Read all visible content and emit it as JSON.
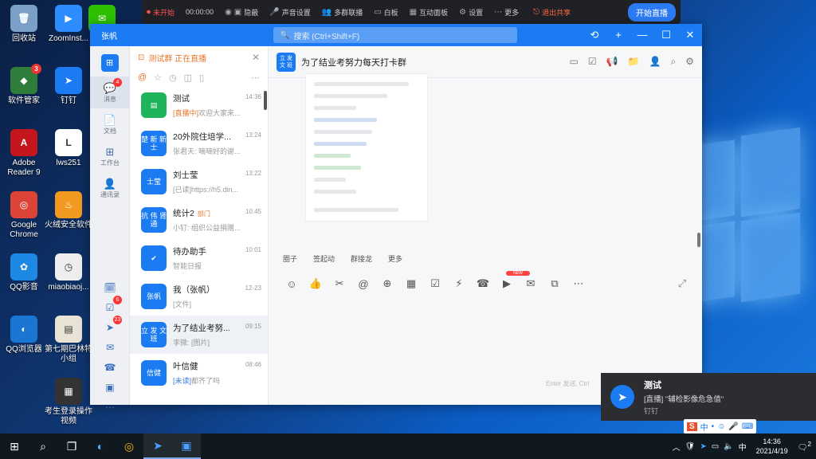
{
  "desktop": {
    "col1": [
      {
        "label": "回收站",
        "icon": "recycle-bin-icon",
        "color": "#7aa0c8",
        "glyph": "🗑"
      },
      {
        "label": "软件管家",
        "icon": "software-manager-icon",
        "color": "#2f7d3a",
        "glyph": "◆",
        "badge": "3"
      },
      {
        "label": "Adobe Reader 9",
        "icon": "adobe-reader-icon",
        "color": "#c4161c",
        "glyph": "A"
      },
      {
        "label": "Google Chrome",
        "icon": "chrome-icon",
        "color": "#db4437",
        "glyph": "◎"
      },
      {
        "label": "QQ影音",
        "icon": "qq-player-icon",
        "color": "#1e88e5",
        "glyph": "✿"
      },
      {
        "label": "QQ浏览器",
        "icon": "qq-browser-icon",
        "color": "#1976d2",
        "glyph": "◐"
      }
    ],
    "col2": [
      {
        "label": "ZoomInst...",
        "icon": "zoom-icon",
        "color": "#2d8cff",
        "glyph": "▶"
      },
      {
        "label": "钉钉",
        "icon": "dingtalk-icon",
        "color": "#1b7bf2",
        "glyph": "➤"
      },
      {
        "label": "lws251",
        "icon": "logitech-icon",
        "color": "#ffffff",
        "glyph": "L"
      },
      {
        "label": "火绒安全软件",
        "icon": "huorong-icon",
        "color": "#f29a1f",
        "glyph": "♨"
      },
      {
        "label": "miaobiaoj...",
        "icon": "stopwatch-icon",
        "color": "#eeeeee",
        "glyph": "◷"
      },
      {
        "label": "第七期巴林特小组",
        "icon": "document-icon",
        "color": "#e9e3d6",
        "glyph": "▤"
      },
      {
        "label": "考生登录操作视频",
        "icon": "video-file-icon",
        "color": "#333333",
        "glyph": "▦"
      }
    ],
    "wechat": {
      "label": "",
      "icon": "wechat-icon",
      "color": "#2dc100",
      "glyph": "✉"
    }
  },
  "meeting_bar": {
    "rec_status": "未开始",
    "timer": "00:00:00",
    "items": [
      "隐蔽",
      "声音设置",
      "多群联播",
      "白板",
      "互动面板",
      "设置",
      "更多"
    ],
    "stop_share": "退出共享",
    "start_live": "开始直播"
  },
  "window": {
    "user": "张帆",
    "search_placeholder": "搜索 (Ctrl+Shift+F)",
    "controls": [
      "⟲",
      "+",
      "—",
      "☐",
      "✕"
    ]
  },
  "nav": {
    "items": [
      {
        "label": "消息",
        "glyph": "💬",
        "badge": "4",
        "active": true
      },
      {
        "label": "文档",
        "glyph": "📄"
      },
      {
        "label": "工作台",
        "glyph": "⊞"
      },
      {
        "label": "通讯录",
        "glyph": "👤"
      }
    ],
    "lower": [
      {
        "glyph": "🗓",
        "badge": ""
      },
      {
        "glyph": "☑",
        "badge": "6"
      },
      {
        "glyph": "➤",
        "badge": "23"
      },
      {
        "glyph": "✉",
        "badge": ""
      },
      {
        "glyph": "☎",
        "badge": ""
      },
      {
        "glyph": "▣",
        "badge": ""
      },
      {
        "glyph": "⋯",
        "badge": ""
      }
    ]
  },
  "convlist": {
    "live_banner": "测试群 正在直播",
    "items": [
      {
        "avatar": "▤",
        "green": true,
        "title": "测试",
        "tag": "",
        "prefix": "[直播中]",
        "prefix_style": "orange",
        "msg": "欢迎大家来...",
        "time": "14:36"
      },
      {
        "avatar": "楚 新 新 士",
        "title": "20外院住培学...",
        "tag": "",
        "prefix": "",
        "msg": "张君天: 嘀嘀好的谢...",
        "time": "13:24"
      },
      {
        "avatar": "士莹",
        "title": "刘士莹",
        "tag": "",
        "prefix": "",
        "msg": "[已读]https://h5.din...",
        "time": "13:22"
      },
      {
        "avatar": "抗 伟 肾 通",
        "title": "统计2",
        "tag": "部门",
        "prefix": "",
        "msg": "小钉: 组织公益捐赠...",
        "time": "10:45"
      },
      {
        "avatar": "✔",
        "title": "待办助手",
        "tag": "",
        "prefix": "",
        "msg": "智能日报",
        "time": "10:01"
      },
      {
        "avatar": "张帆",
        "title": "我（张帆）",
        "tag": "",
        "prefix": "",
        "msg": "[文件]",
        "time": "12-23"
      },
      {
        "avatar": "立 发 文 班",
        "title": "为了结业考努...",
        "tag": "",
        "prefix": "",
        "msg": "李微: [图片]",
        "time": "09:15",
        "selected": true
      },
      {
        "avatar": "信健",
        "title": "叶信健",
        "tag": "",
        "prefix": "[未读]",
        "prefix_style": "blue",
        "msg": "都齐了吗",
        "time": "08:46"
      }
    ]
  },
  "chat": {
    "group_avatar": "立 发 文 班",
    "group_name": "为了结业考努力每天打卡群",
    "quick_actions": [
      "圈子",
      "签起动",
      "群接龙",
      "更多"
    ],
    "toolbar_icons": [
      "☺",
      "👍",
      "✂",
      "@",
      "⊕",
      "▦",
      "☑",
      "⚡",
      "☎",
      "▶",
      "✉",
      "⧉",
      "⋯"
    ],
    "new_label": "NEW",
    "hint": "Enter 发送, Ctrl"
  },
  "toast": {
    "title": "测试",
    "message": "[直播] \"辅检影像危急值\"",
    "app": "钉钉"
  },
  "taskbar": {
    "time": "14:36",
    "date": "2021/4/19",
    "ime": [
      "S",
      "中",
      "•",
      "☺",
      "🎤",
      "⌨"
    ],
    "tray_text": "中",
    "notif_count": "2"
  }
}
